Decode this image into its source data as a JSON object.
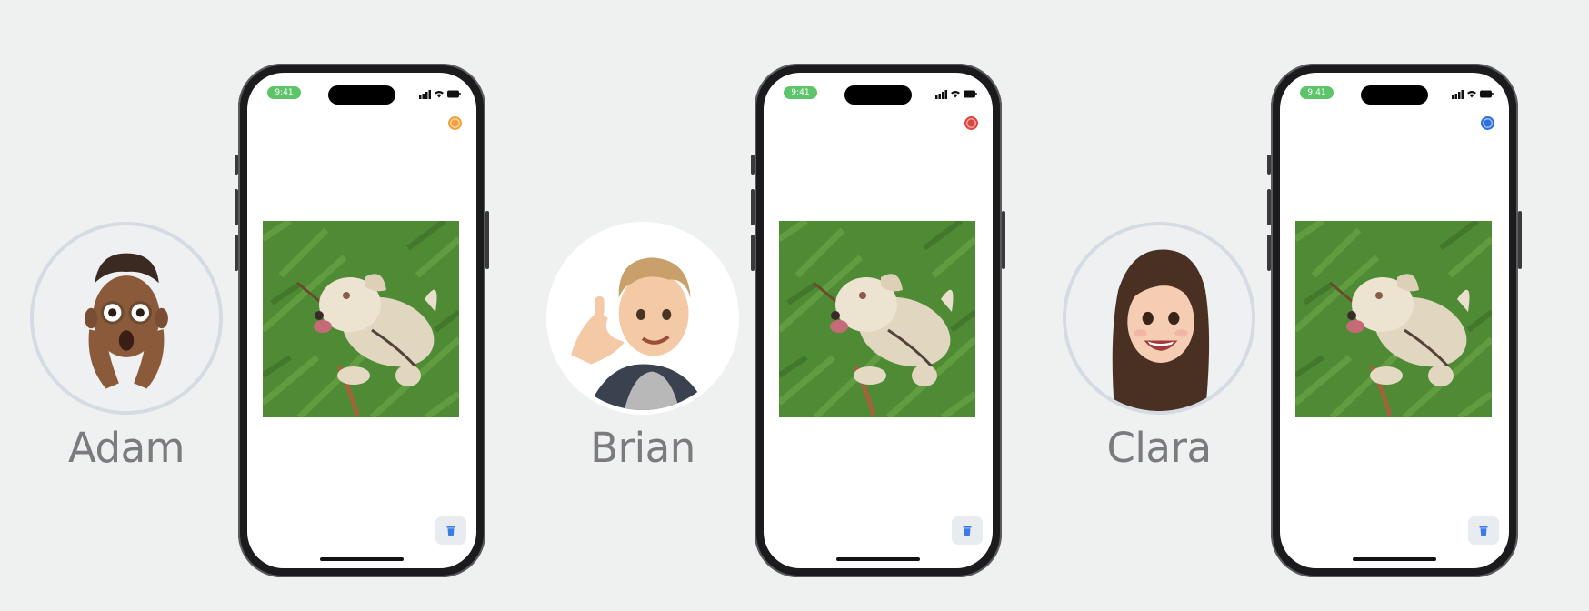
{
  "users": [
    {
      "name": "Adam",
      "active": false,
      "indicator_color": "#f0a13a",
      "status_time": "9:41",
      "photo_description_icon": "dog-on-grass-photo",
      "action_icon": "trash-icon"
    },
    {
      "name": "Brian",
      "active": true,
      "indicator_color": "#e0443e",
      "status_time": "9:41",
      "photo_description_icon": "dog-on-grass-photo",
      "action_icon": "trash-icon"
    },
    {
      "name": "Clara",
      "active": false,
      "indicator_color": "#2f6fe0",
      "status_time": "9:41",
      "photo_description_icon": "dog-on-grass-photo",
      "action_icon": "trash-icon"
    }
  ],
  "colors": {
    "background": "#eff0f0",
    "phone_frame": "#1b1b1d",
    "status_pill": "#5ec46a",
    "name_text": "#7b7b7f"
  }
}
